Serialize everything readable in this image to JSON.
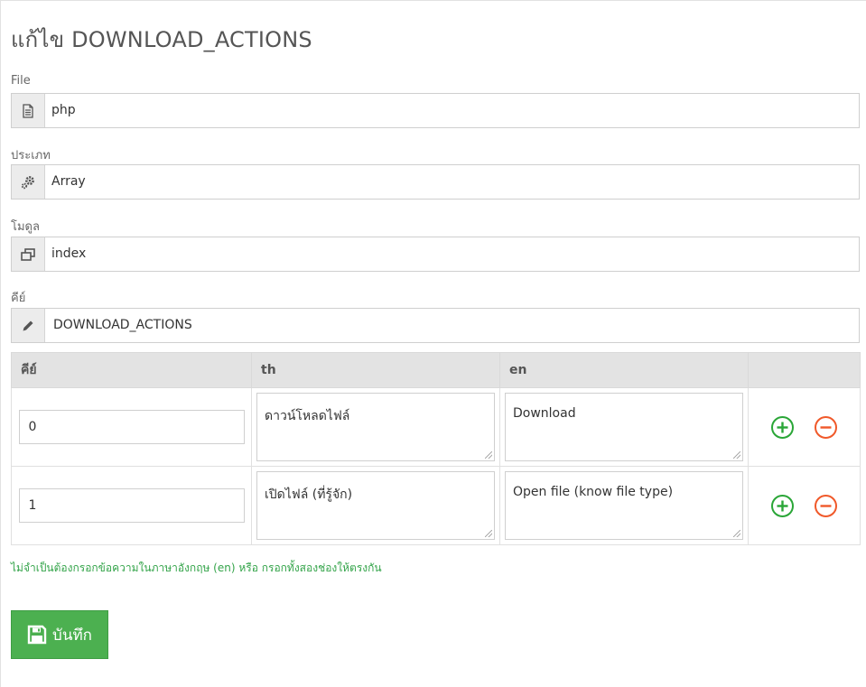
{
  "page": {
    "title": "แก้ไข DOWNLOAD_ACTIONS"
  },
  "form": {
    "file": {
      "label": "File",
      "icon": "file-icon",
      "value": "php"
    },
    "type": {
      "label": "ประเภท",
      "icon": "gears-icon",
      "value": "Array"
    },
    "module": {
      "label": "โมดูล",
      "icon": "windows-icon",
      "value": "index"
    },
    "key": {
      "label": "คีย์",
      "icon": "pencil-icon",
      "value": "DOWNLOAD_ACTIONS"
    }
  },
  "table": {
    "headers": [
      "คีย์",
      "th",
      "en",
      ""
    ],
    "rows": [
      {
        "key": "0",
        "th": "ดาวน์โหลดไฟล์",
        "en": "Download"
      },
      {
        "key": "1",
        "th": "เปิดไฟล์ (ที่รู้จัก)",
        "en": "Open file (know file type)"
      }
    ]
  },
  "hint": "ไม่จำเป็นต้องกรอกข้อความในภาษาอังกฤษ (en) หรือ กรอกทั้งสองช่องให้ตรงกัน",
  "save_button": {
    "label": "บันทึก",
    "icon": "floppy-disk-icon"
  },
  "colors": {
    "add": "#2aa637",
    "remove": "#f0592a",
    "save": "#4cb050",
    "hint": "#34a44a"
  }
}
